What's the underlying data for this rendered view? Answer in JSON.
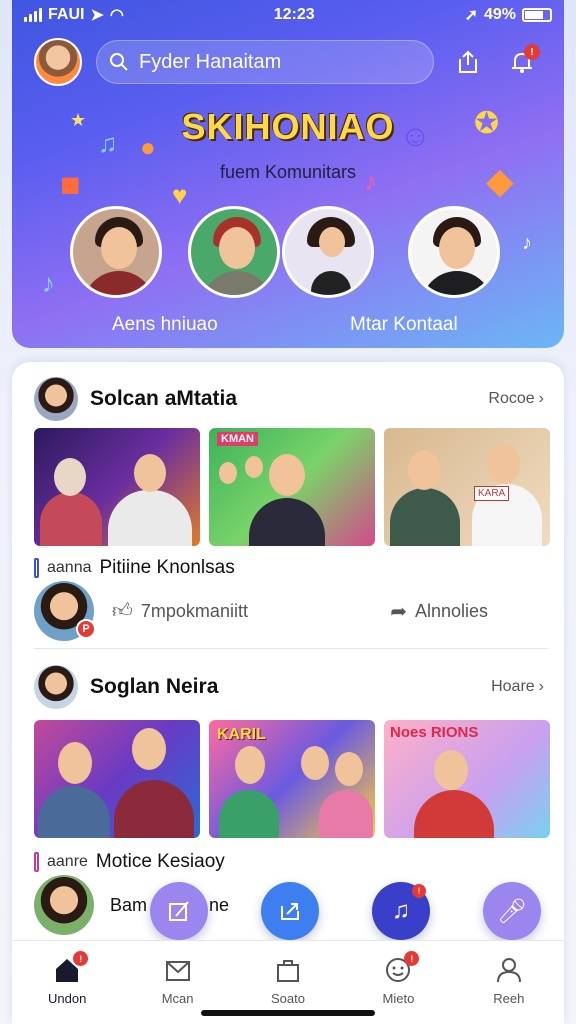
{
  "status_bar": {
    "carrier": "FAUI",
    "time": "12:23",
    "battery_text": "49%"
  },
  "header": {
    "search_placeholder": "Fyder Hanaitam"
  },
  "banner": {
    "title": "SKIHONIAO",
    "subtitle": "fuem Komunitars",
    "left_label": "Aens  hniuao",
    "right_label": "Mtar Kontaal"
  },
  "sections": [
    {
      "title": "Solcan aMtatia",
      "more_label": "Rocoe",
      "tag_prefix": "aanna",
      "tag_label": "Pitiine Knonlsas",
      "action_left": "7mpokmaniitt",
      "action_right": "Alnnolies"
    },
    {
      "title": "Soglan Neira",
      "more_label": "Hoare",
      "tag_prefix": "aanre",
      "tag_label": "Motice Kesiaoy",
      "partial_text": "Bam",
      "partial_text_tail": "ne"
    }
  ],
  "thumb_texts": {
    "row1_sign": "KMAN",
    "row1_card": "KARA",
    "row2_sign": "KARIL",
    "row2_card": "Noes RIONS"
  },
  "nav": [
    {
      "label": "Undon",
      "active": true,
      "badge": "!"
    },
    {
      "label": "Mcan",
      "active": false
    },
    {
      "label": "Soato",
      "active": false
    },
    {
      "label": "Mieto",
      "active": false,
      "badge": "!"
    },
    {
      "label": "Reeh",
      "active": false
    }
  ],
  "colors": {
    "accent": "#3b50d6",
    "badge": "#e53935",
    "fab_lavender": "#9a86ee",
    "fab_blue": "#3d7ff0",
    "fab_indigo": "#3a3fc9"
  }
}
